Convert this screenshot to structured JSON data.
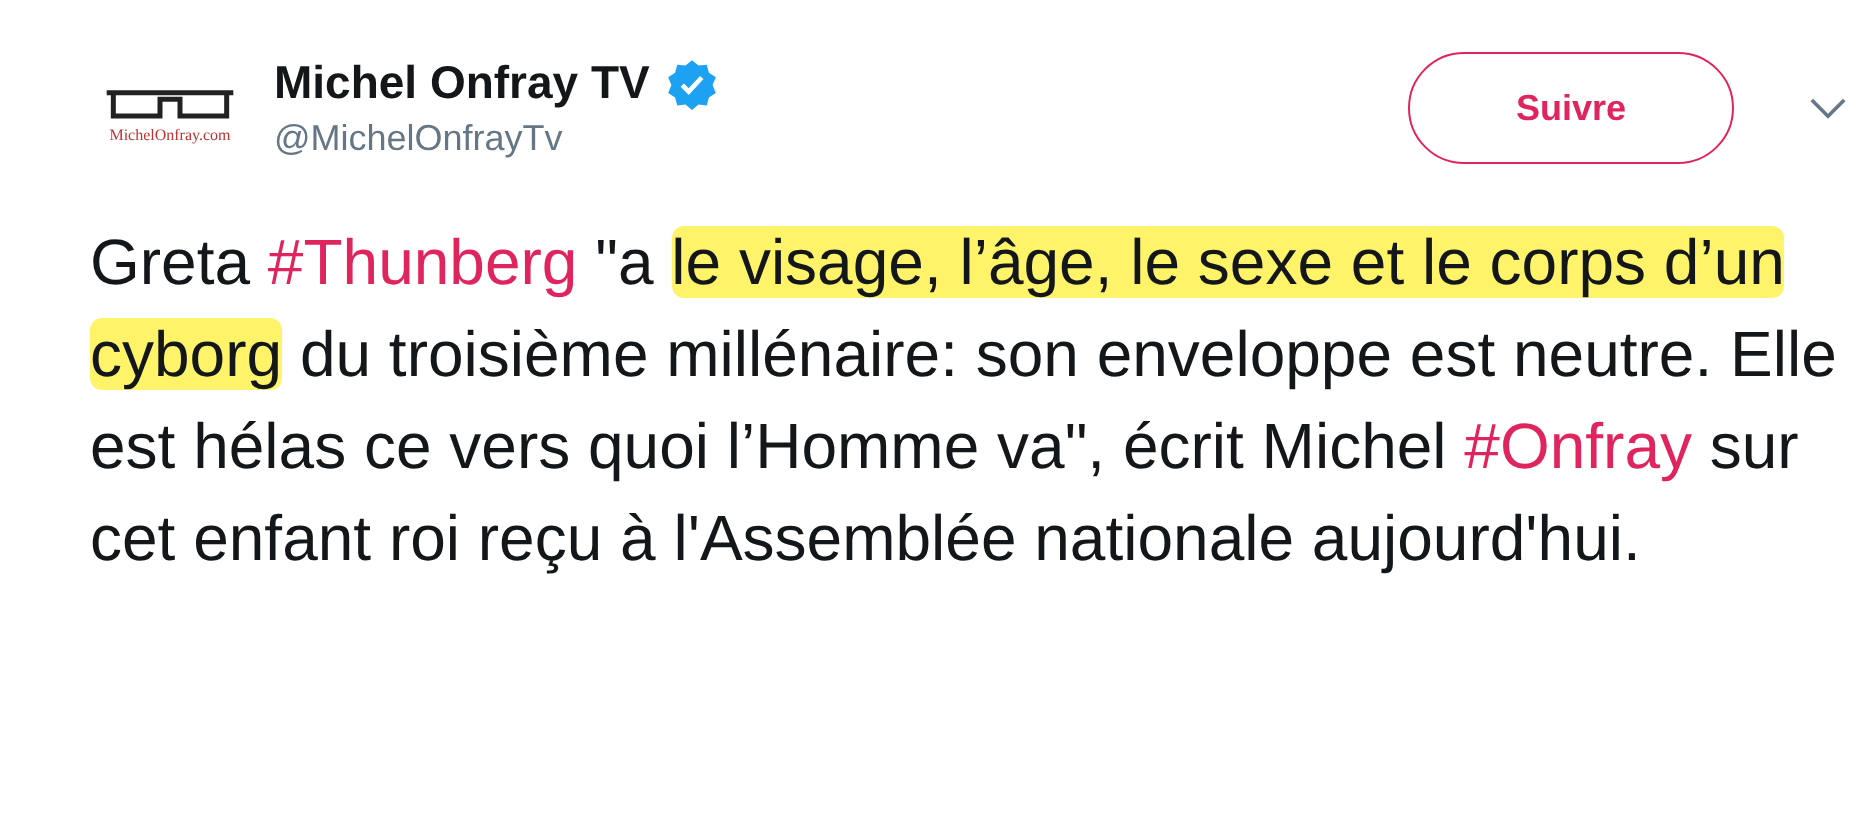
{
  "author": {
    "name": "Michel Onfray TV",
    "verified": true,
    "handle": "@MichelOnfrayTv",
    "avatar_caption": "MichelOnfray.com"
  },
  "follow_button": "Suivre",
  "tweet_text": [
    {
      "kind": "plain",
      "text": "Greta "
    },
    {
      "kind": "hashtag",
      "text": "#Thunberg"
    },
    {
      "kind": "plain",
      "text": " \"a "
    },
    {
      "kind": "highlight",
      "text": "le visage, l’âge, le sexe et le corps d’un cyborg"
    },
    {
      "kind": "plain",
      "text": " du troisième millénaire: son enveloppe est neutre. Elle est hélas ce vers quoi l’Homme va\", écrit Michel "
    },
    {
      "kind": "hashtag",
      "text": "#Onfray"
    },
    {
      "kind": "plain",
      "text": " sur cet enfant roi reçu à l'Assemblée nationale aujourd'hui."
    }
  ]
}
